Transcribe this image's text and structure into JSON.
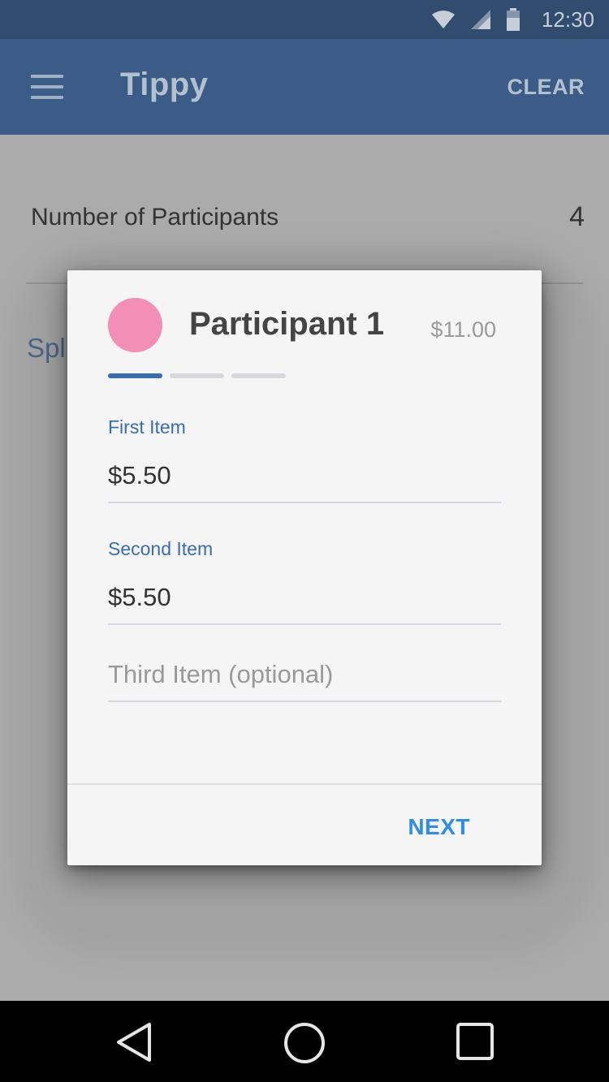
{
  "status_bar": {
    "time": "12:30",
    "icons": [
      "wifi-icon",
      "signal-icon",
      "battery-icon"
    ]
  },
  "app_bar": {
    "title": "Tippy",
    "clear_label": "CLEAR",
    "menu_icon": "hamburger-menu-icon"
  },
  "content": {
    "participants_label": "Number of Participants",
    "participants_value": "4",
    "split_label_partial": "Spl"
  },
  "dialog": {
    "participant_name": "Participant 1",
    "participant_total": "$11.00",
    "avatar_color": "#f38fb6",
    "progress": {
      "current_step": 1,
      "total_steps": 3
    },
    "fields": [
      {
        "label": "First Item",
        "value": "$5.50",
        "placeholder": ""
      },
      {
        "label": "Second Item",
        "value": "$5.50",
        "placeholder": ""
      },
      {
        "label": "",
        "value": "",
        "placeholder": "Third Item (optional)"
      }
    ],
    "next_label": "NEXT"
  },
  "nav_bar": {
    "icons": [
      "back-icon",
      "home-icon",
      "recents-icon"
    ]
  },
  "colors": {
    "primary": "#3a5c87",
    "primary_dark": "#314c6e",
    "accent": "#2f8de6",
    "label_blue": "#3a6db0"
  }
}
